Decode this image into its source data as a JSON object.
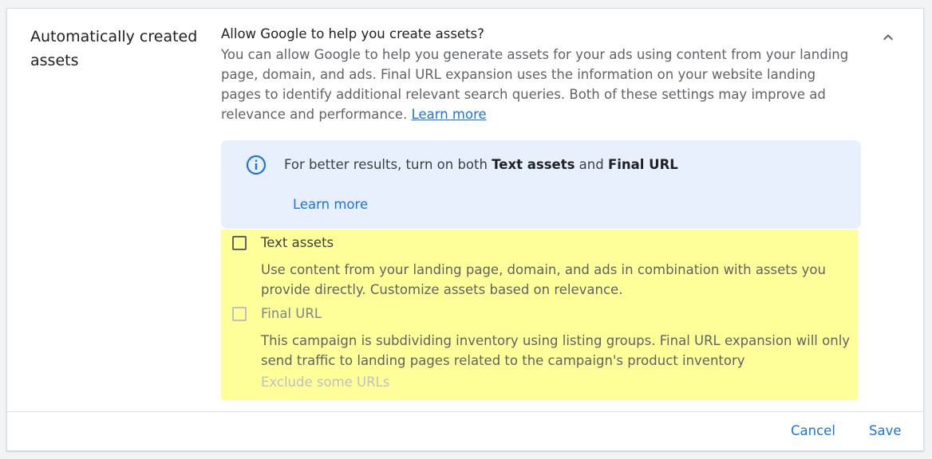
{
  "section": {
    "label": "Automatically created assets"
  },
  "content": {
    "question": "Allow Google to help you create assets?",
    "description": "You can allow Google to help you generate assets for your ads using content from your landing page, domain, and ads. Final URL expansion uses the information on your website landing pages to identify additional relevant search queries. Both of these settings may improve ad relevance and performance.",
    "learn_more": "Learn more"
  },
  "info": {
    "icon": "info-icon",
    "text_prefix": "For better results, turn on both ",
    "text_bold1": "Text assets",
    "text_middle": " and ",
    "text_bold2": "Final URL",
    "learn_more": "Learn more"
  },
  "options": {
    "text_assets": {
      "label": "Text assets",
      "description": "Use content from your landing page, domain, and ads in combination with assets you provide directly. Customize assets based on relevance."
    },
    "final_url": {
      "label": "Final URL",
      "description": "This campaign is subdividing inventory using listing groups. Final URL expansion will only send traffic to landing pages related to the campaign's product inventory",
      "exclude_link": "Exclude some URLs"
    }
  },
  "footer": {
    "cancel": "Cancel",
    "save": "Save"
  },
  "colors": {
    "accent": "#1a73e8",
    "info_bg": "#e8f0fe",
    "highlight": "#ffff99"
  }
}
